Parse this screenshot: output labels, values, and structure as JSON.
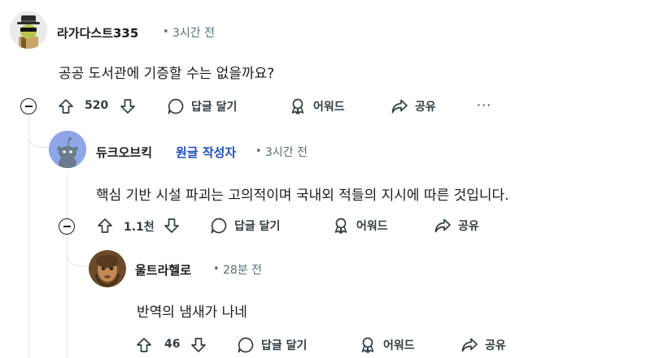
{
  "comments": [
    {
      "author": "라가다스트335",
      "op_badge": "",
      "dot": "•",
      "time": "3시간 전",
      "body": "공공 도서관에 기증할 수는 없을까요?",
      "votes": "520",
      "reply_label": "답글 달기",
      "award_label": "어워드",
      "share_label": "공유",
      "more_label": "···"
    },
    {
      "author": "듀크오브킥",
      "op_badge": "원글 작성자",
      "dot": "•",
      "time": "3시간 전",
      "body": "핵심 기반 시설 파괴는 고의적이며 국내외 적들의 지시에 따른 것입니다.",
      "votes": "1.1천",
      "reply_label": "답글 달기",
      "award_label": "어워드",
      "share_label": "공유"
    },
    {
      "author": "울트라헬로",
      "op_badge": "",
      "dot": "•",
      "time": "28분 전",
      "body": "반역의 냄새가 나네",
      "votes": "46",
      "reply_label": "답글 달기",
      "award_label": "어워드",
      "share_label": "공유"
    }
  ],
  "colors": {
    "text": "#1c1c1c",
    "meta": "#576f76",
    "op_badge": "#1d4fbf",
    "thread_line": "#e2e4e6",
    "snoo_avatar_bg": "#8ea5e8"
  },
  "icons": [
    "upvote-icon",
    "downvote-icon",
    "reply-bubble-icon",
    "award-icon",
    "share-arrow-icon",
    "collapse-minus-icon",
    "more-dots-icon"
  ]
}
